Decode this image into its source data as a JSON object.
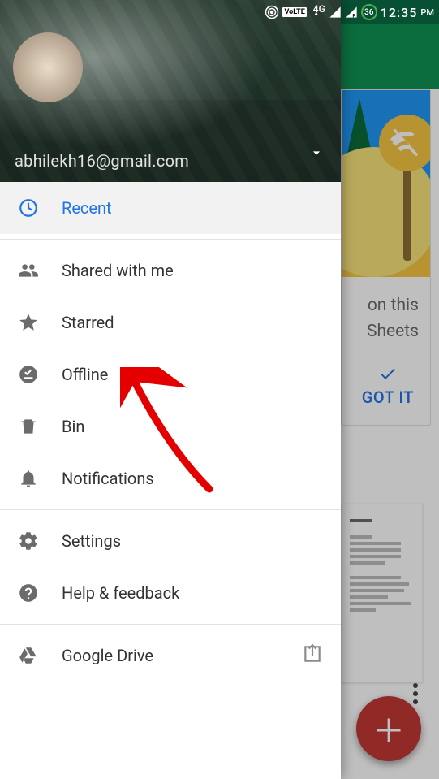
{
  "status": {
    "network_label": "4G",
    "battery_pct": "36",
    "time": "12:35",
    "ampm": "PM",
    "volte_label": "VoLTE"
  },
  "drawer": {
    "account_email": "abhilekh16@gmail.com",
    "items": {
      "recent": {
        "label": "Recent"
      },
      "shared": {
        "label": "Shared with me"
      },
      "starred": {
        "label": "Starred"
      },
      "offline": {
        "label": "Offline"
      },
      "bin": {
        "label": "Bin"
      },
      "notifications": {
        "label": "Notifications"
      },
      "settings": {
        "label": "Settings"
      },
      "help": {
        "label": "Help & feedback"
      },
      "drive": {
        "label": "Google Drive"
      }
    }
  },
  "back": {
    "card_line1": "on this",
    "card_line2": "Sheets",
    "got_it": "GOT IT"
  },
  "fab_plus": "＋"
}
